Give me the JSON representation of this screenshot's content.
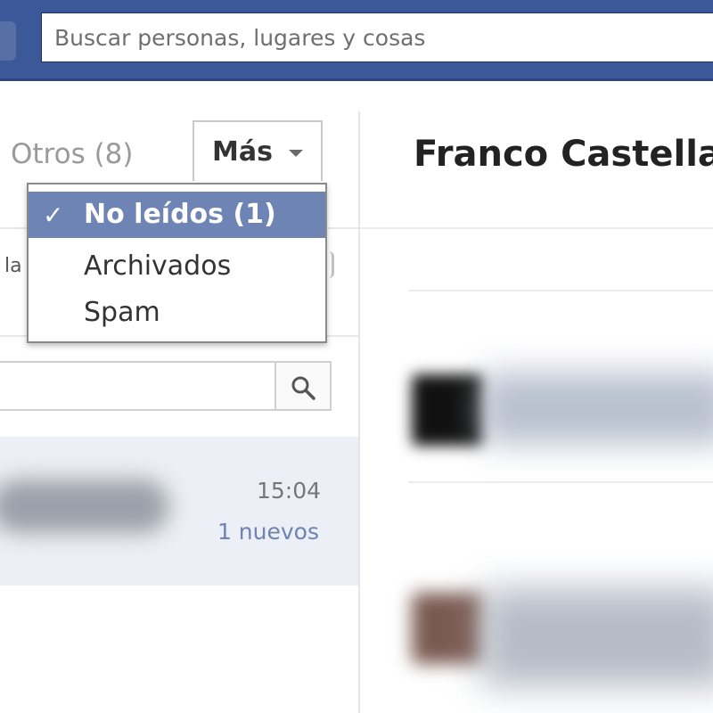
{
  "header": {
    "search_placeholder": "Buscar personas, lugares y cosas"
  },
  "inbox": {
    "other_tab_label": "Otros (8)",
    "more_button_label": "Más",
    "partial_text": "la",
    "search_placeholder": ""
  },
  "dropdown": {
    "items": [
      {
        "label": "No leídos (1)",
        "selected": true,
        "check": "✓"
      },
      {
        "label": "Archivados",
        "selected": false
      },
      {
        "label": "Spam",
        "selected": false
      }
    ]
  },
  "conversation": {
    "time": "15:04",
    "badge": "1 nuevos"
  },
  "thread": {
    "title": "Franco Castella"
  },
  "colors": {
    "brand": "#3b5998",
    "selected": "#6d84b4",
    "row_highlight": "#eceff5"
  },
  "icons": {
    "search": "magnifier-icon",
    "caret": "chevron-down-icon",
    "check": "checkmark-icon"
  }
}
